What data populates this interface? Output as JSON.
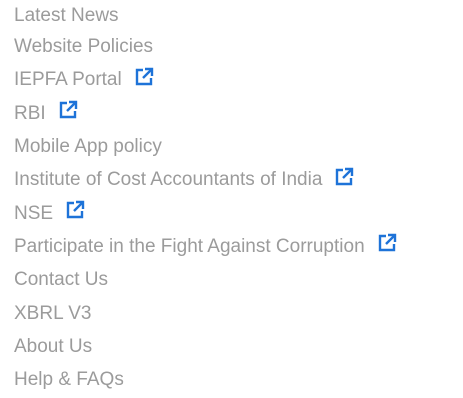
{
  "links": [
    {
      "label": "Latest News",
      "external": false
    },
    {
      "label": "Website Policies",
      "external": false
    },
    {
      "label": "IEPFA Portal",
      "external": true,
      "icon": "external-link-icon"
    },
    {
      "label": "RBI",
      "external": true,
      "icon": "external-link-icon"
    },
    {
      "label": "Mobile App policy",
      "external": false
    },
    {
      "label": "Institute of Cost Accountants of India",
      "external": true,
      "icon": "external-link-icon"
    },
    {
      "label": "NSE",
      "external": true,
      "icon": "external-link-icon"
    },
    {
      "label": "Participate in the Fight Against Corruption",
      "external": true,
      "icon": "external-link-icon"
    },
    {
      "label": "Contact Us",
      "external": false
    },
    {
      "label": "XBRL V3",
      "external": false
    },
    {
      "label": "About Us",
      "external": false
    },
    {
      "label": "Help & FAQs",
      "external": false
    }
  ],
  "colors": {
    "link_text": "#9b9b9b",
    "icon": "#1e73d8"
  }
}
